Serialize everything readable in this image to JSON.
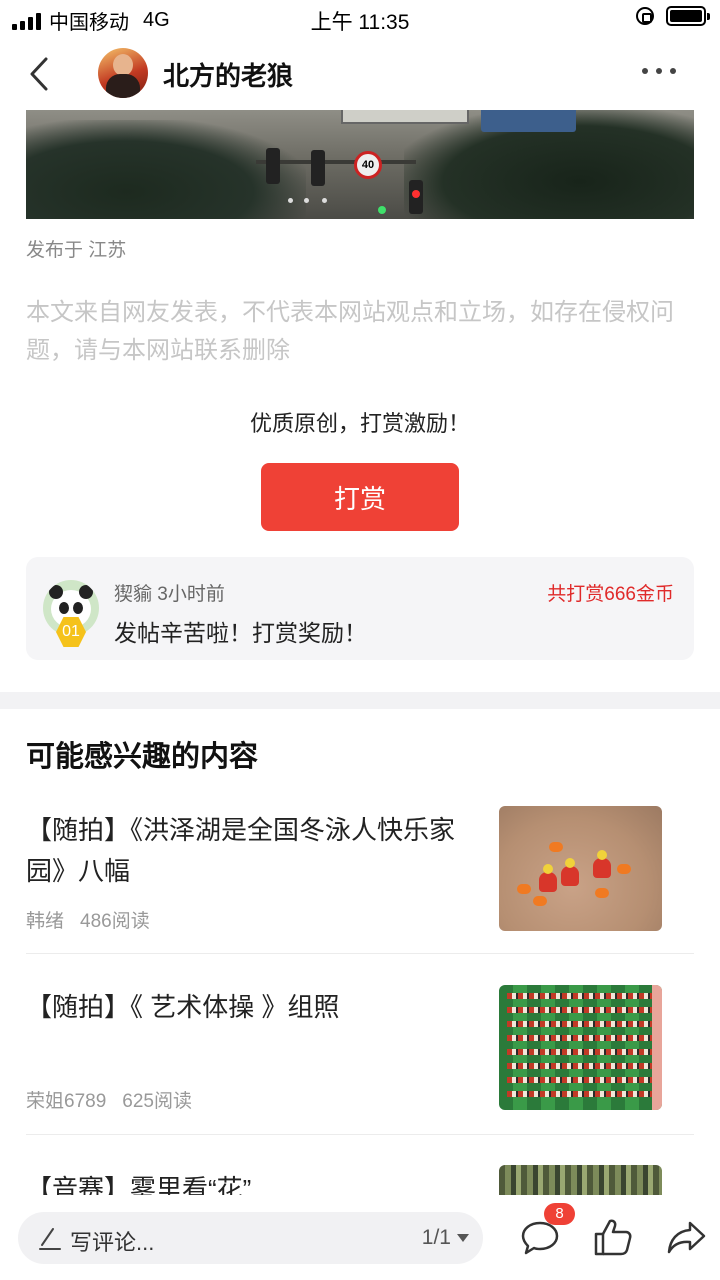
{
  "status_bar": {
    "carrier": "中国移动",
    "network": "4G",
    "time": "上午 11:35"
  },
  "nav": {
    "author_name": "北方的老狼",
    "icons": [
      "chevron-left-icon",
      "more-dots-icon"
    ]
  },
  "post": {
    "location": "发布于 江苏",
    "disclaimer": "本文来自网友发表，不代表本网站观点和立场，如存在侵权问题，请与本网站联系删除"
  },
  "reward": {
    "prompt": "优质原创，打赏激励！",
    "button_label": "打赏",
    "record": {
      "user": "猰貐 3小时前",
      "rank": "01",
      "total": "共打赏666金币",
      "message": "发帖辛苦啦！打赏奖励！"
    }
  },
  "recommend": {
    "section_title": "可能感兴趣的内容",
    "items": [
      {
        "title": "【随拍】《洪泽湖是全国冬泳人快乐家园》八幅",
        "author": "韩绪",
        "reads": "486阅读"
      },
      {
        "title": "【随拍】《 艺术体操 》组照",
        "author": "荣姐6789",
        "reads": "625阅读"
      },
      {
        "title": "【音赛】雾里看“花”",
        "author": "",
        "reads": ""
      }
    ]
  },
  "bottom_bar": {
    "comment_placeholder": "写评论...",
    "page_indicator": "1/1",
    "comment_count": "8"
  },
  "colors": {
    "accent": "#ef4136",
    "reward_total": "#e02a2a",
    "rank_badge": "#f5c21b"
  }
}
